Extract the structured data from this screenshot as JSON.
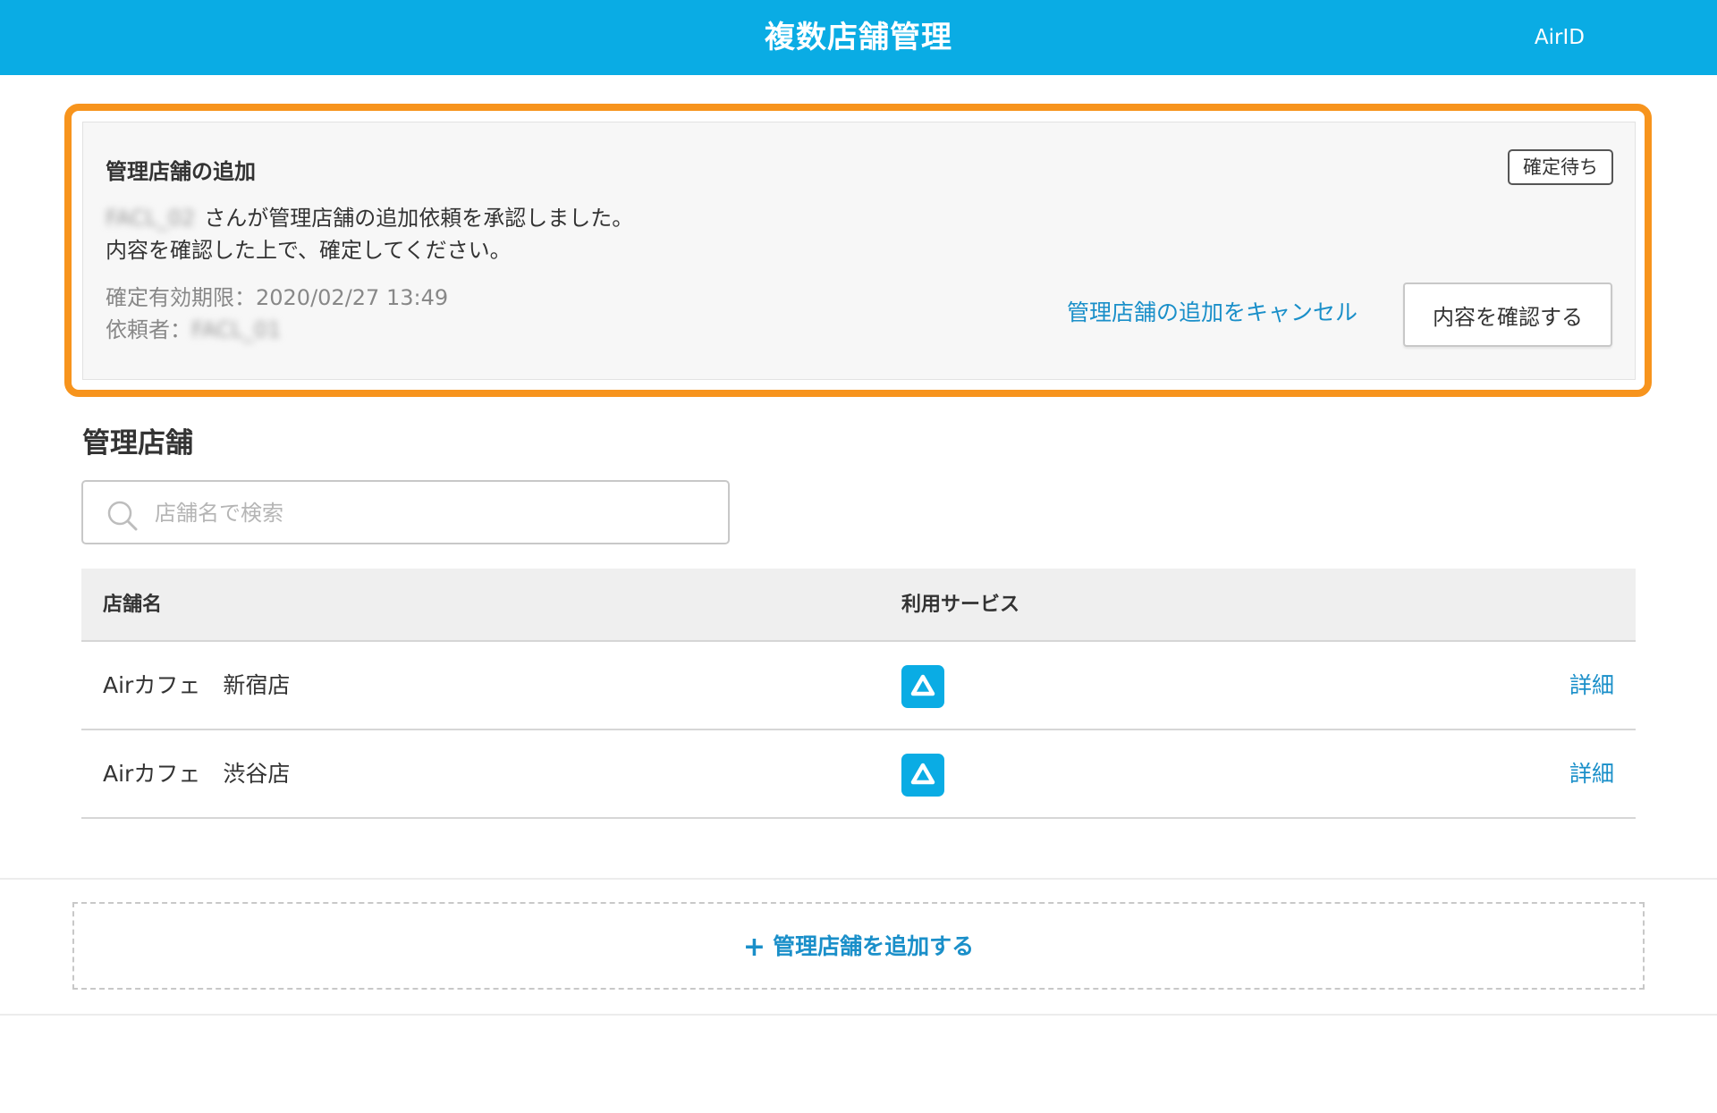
{
  "header": {
    "title": "複数店舗管理",
    "account_link": "AirID"
  },
  "notice": {
    "title": "管理店舗の追加",
    "status_badge": "確定待ち",
    "blurred_requester_shop": "FACL_02",
    "message_line1": "さんが管理店舗の追加依頼を承認しました。",
    "message_line2": "内容を確認した上で、確定してください。",
    "expiry_label": "確定有効期限：",
    "expiry_value": "2020/02/27 13:49",
    "requester_label": "依頼者：",
    "requester_value": "FACL_01",
    "cancel_link": "管理店舗の追加をキャンセル",
    "confirm_button": "内容を確認する"
  },
  "stores": {
    "section_title": "管理店舗",
    "search_placeholder": "店舗名で検索",
    "columns": [
      "店舗名",
      "利用サービス"
    ],
    "rows": [
      {
        "name": "Airカフェ　新宿店",
        "service_icon": "air-service-icon",
        "detail": "詳細"
      },
      {
        "name": "Airカフェ　渋谷店",
        "service_icon": "air-service-icon",
        "detail": "詳細"
      }
    ]
  },
  "footer": {
    "add_store_button": "管理店舗を追加する"
  },
  "colors": {
    "header_bg": "#0aace4",
    "highlight_border": "#f7941d",
    "link": "#1a8fc9"
  }
}
